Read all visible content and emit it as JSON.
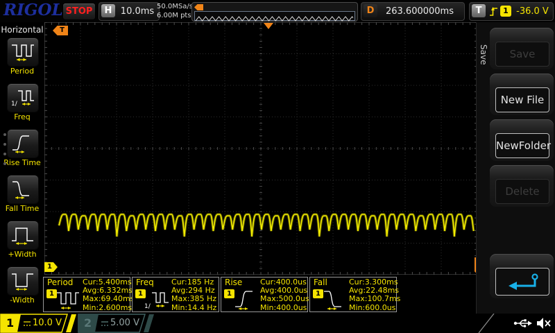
{
  "top_bar": {
    "logo": "RIGOL",
    "run_state": "STOP",
    "h_label": "H",
    "timebase": "10.0ms",
    "sample_rate": "50.0MSa/s",
    "mem_depth": "6.00M pts",
    "d_label": "D",
    "delay": "263.600000ms",
    "t_label": "T",
    "trig_source": "1",
    "trig_level": "-36.0 V"
  },
  "left_menu": {
    "title": "Horizontal",
    "freq_icon_prefix": "1/",
    "items": [
      "Period",
      "Freq",
      "Rise Time",
      "Fall Time",
      "+Width",
      "-Width"
    ]
  },
  "right_menu": {
    "tab_title": "Save",
    "items": [
      {
        "label": "Save",
        "enabled": false
      },
      {
        "label": "New File",
        "enabled": true
      },
      {
        "label": "NewFolder",
        "enabled": true
      },
      {
        "label": "Delete",
        "enabled": false
      },
      {
        "label": "",
        "enabled": true,
        "icon": "return-arrow-icon"
      }
    ]
  },
  "measurements": [
    {
      "name": "Period",
      "source": "1",
      "rows": [
        "Cur:5.400ms",
        "Avg:6.332ms",
        "Max:69.40ms",
        "Min:2.600ms"
      ]
    },
    {
      "name": "Freq",
      "source": "1",
      "rows": [
        "Cur:185 Hz",
        "Avg:294 Hz",
        "Max:385 Hz",
        "Min:14.4 Hz"
      ]
    },
    {
      "name": "Rise",
      "source": "1",
      "rows": [
        "Cur:400.0us",
        "Avg:400.0us",
        "Max:500.0us",
        "Min:400.0us"
      ]
    },
    {
      "name": "Fall",
      "source": "1",
      "rows": [
        "Cur:3.300ms",
        "Avg:22.48ms",
        "Max:100.7ms",
        "Min:600.0us"
      ]
    }
  ],
  "channels": [
    {
      "number": "1",
      "scale": "10.0 V",
      "active": true
    },
    {
      "number": "2",
      "scale": "5.00 V",
      "active": false
    }
  ],
  "markers": {
    "trigger_position_label": "T",
    "trigger_level_label": "T",
    "channel_label": "1"
  },
  "icons": [
    "usb-icon",
    "speaker-muted-icon",
    "return-arrow-icon",
    "dc-coupling-icon",
    "trigger-edge-icon",
    "waveform-preview-marker-icon"
  ],
  "colors": {
    "ch1_yellow": "#f5e400",
    "waveform_yellow": "#f4ee00",
    "trigger_orange": "#f08418",
    "stop_red": "#ff1f1f",
    "logo_blue": "#1d2f9e",
    "back_cyan": "#18b0e8",
    "ch2_inactive": "#5a7878"
  }
}
